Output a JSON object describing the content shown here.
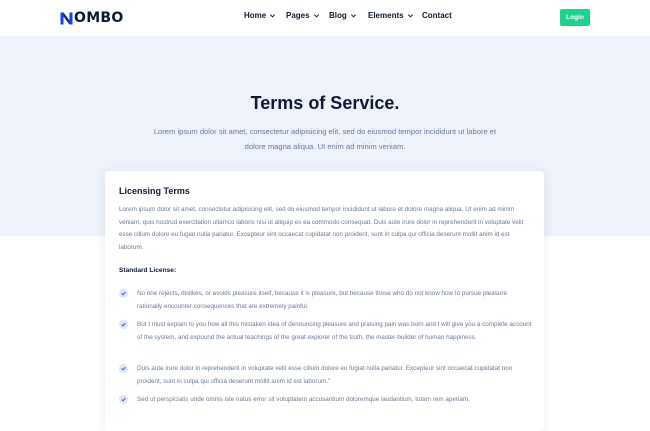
{
  "brand": {
    "name": "OMBO"
  },
  "nav": {
    "items": [
      {
        "label": "Home",
        "has_dropdown": true
      },
      {
        "label": "Pages",
        "has_dropdown": true
      },
      {
        "label": "Blog",
        "has_dropdown": true
      },
      {
        "label": "Elements",
        "has_dropdown": true
      },
      {
        "label": "Contact",
        "has_dropdown": false
      }
    ],
    "login_label": "Login"
  },
  "hero": {
    "title": "Terms of Service.",
    "subtitle": "Lorem ipsum dolor sit amet, consectetur adipisicing elit, sed do eiusmod tempor incididunt ut labore et dolore magna aliqua. Ut enim ad minim veniam."
  },
  "card": {
    "title": "Licensing Terms",
    "paragraph": "Lorem ipsum dolor sit amet, consectetur adipisicing elit, sed do eiusmod tempor incididunt ut labore et dolore magna aliqua. Ut enim ad minim veniam, quis nostrud exercitation ullamco laboris nisi ut aliquip ex ea commodo consequat. Duis aute irure dolor in reprehenderit in voluptate velit esse cillum dolore eu fugiat nulla pariatur. Excepteur sint occaecat cupidatat non proident, sunt in culpa qui officia deserunt mollit anim id est laborum.",
    "standard_label": "Standard License:",
    "items": [
      "No one rejects, dislikes, or avoids pleasure itself, because it is pleasure, but because those who do not know how to pursue pleasure rationally encounter consequences that are extremely painful.",
      "But I must explain to you how all this mistaken idea of denouncing pleasure and praising pain was born and I will give you a complete account of the system, and expound the actual teachings of the great explorer of the truth, the master-builder of human happiness.",
      "Duis aute irure dolor in reprehenderit in voluptate velit esse cillum dolore eu fugiat nulla pariatur. Excepteur sint occaecat cupidatat non proident, sunt in culpa qui officia deserunt mollit anim id est laborum.\"",
      "Sed ut perspiciatis unde omnis iste natus error sit voluptatem accusantium doloremque laudantium, totam rem aperiam,"
    ]
  },
  "colors": {
    "accent": "#1fd28f",
    "brand_blue": "#1a3cff",
    "hero_background": "#eef2fa",
    "heading": "#0b1a33",
    "body_text": "#6a7a96"
  },
  "icons": {
    "logo": "logo-mark-icon",
    "dropdown": "chevron-down-icon",
    "list_bullet": "check-icon"
  }
}
